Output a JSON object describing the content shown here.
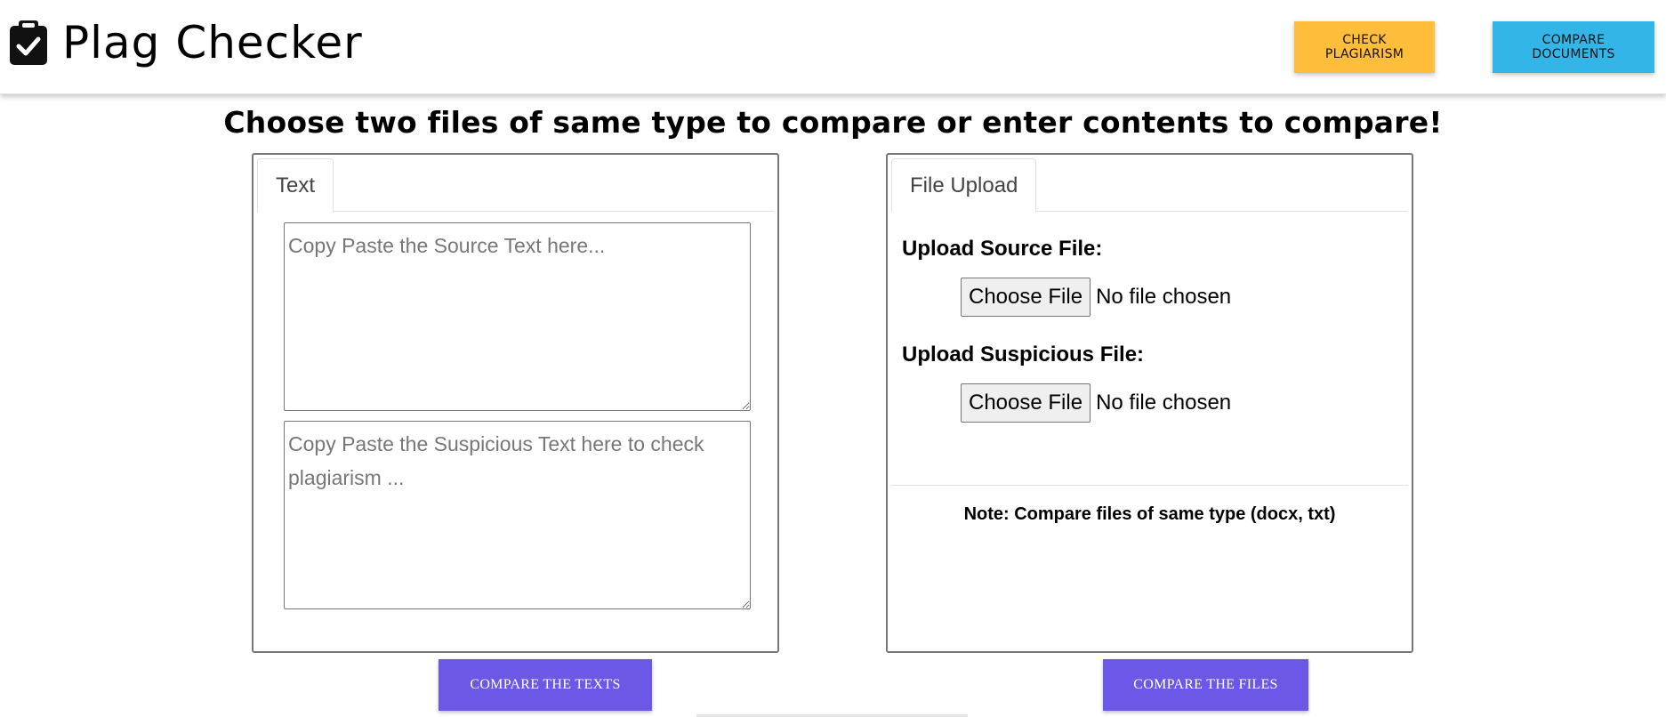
{
  "header": {
    "title": "Plag Checker",
    "brand_icon": "clipboard-check-icon",
    "nav": {
      "check_plagiarism": "CHECK PLAGIARISM",
      "compare_documents": "COMPARE DOCUMENTS"
    },
    "colors": {
      "check_button": "#ffbd3c",
      "compare_button": "#33b5e8"
    }
  },
  "main": {
    "heading": "Choose two files of same type to compare or enter contents to compare!",
    "text_panel": {
      "tab_label": "Text",
      "source_placeholder": "Copy Paste the Source Text here...",
      "suspicious_placeholder": "Copy Paste the Suspicious Text here to check plagiarism ...",
      "action_label": "COMPARE THE TEXTS"
    },
    "file_panel": {
      "tab_label": "File Upload",
      "source_label": "Upload Source File:",
      "suspicious_label": "Upload Suspicious File:",
      "choose_file_label": "Choose File",
      "no_file_text": "No file chosen",
      "note": "Note: Compare files of same type (docx, txt)",
      "action_label": "COMPARE THE FILES"
    },
    "colors": {
      "action_button": "#6c58e6"
    }
  }
}
